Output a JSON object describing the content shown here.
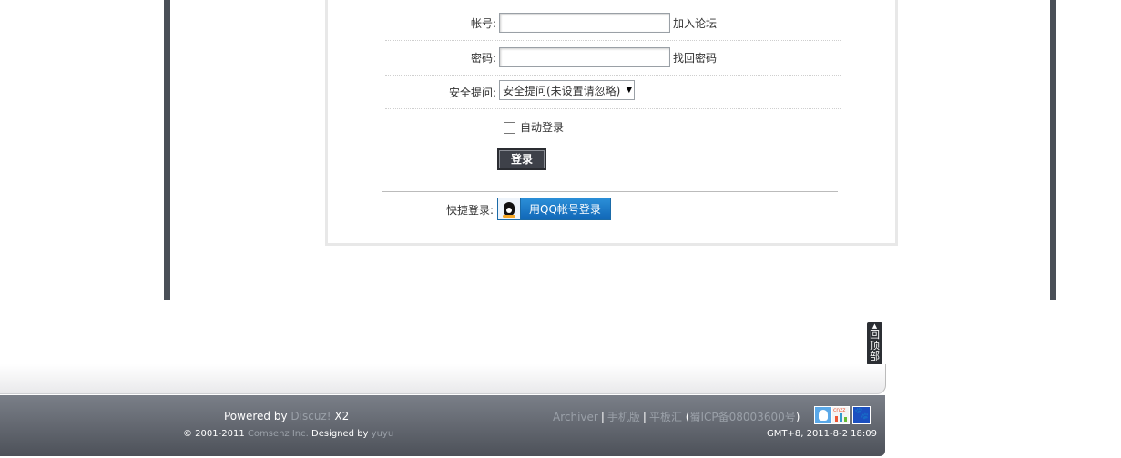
{
  "login": {
    "username_label": "帐号:",
    "username_value": "",
    "register_link": "加入论坛",
    "password_label": "密码:",
    "password_value": "",
    "forgot_link": "找回密码",
    "security_label": "安全提问:",
    "security_selected": "安全提问(未设置请忽略)",
    "auto_login_label": "自动登录",
    "auto_login_checked": false,
    "submit_label": "登录",
    "quick_login_label": "快捷登录:",
    "qq_login_label": "用QQ帐号登录"
  },
  "back_to_top": {
    "label": "回顶部"
  },
  "footer": {
    "powered_prefix": "Powered by",
    "powered_product": "Discuz!",
    "powered_version": "X2",
    "copyright": "© 2001-2011",
    "company": "Comsenz Inc.",
    "designed_by": "Designed by",
    "designer": "yuyu",
    "links": [
      "Archiver",
      "手机版",
      "平板汇"
    ],
    "icp_open": "(",
    "icp": "蜀ICP备08003600号",
    "icp_close": ")",
    "cnzz_label": "cnzz",
    "timestamp": "GMT+8, 2011-8-2 18:09",
    "badges": [
      "qq-icon",
      "cnzz-icon",
      "baidu-icon"
    ]
  },
  "colors": {
    "frame": "#4a4f57",
    "qq_button": "#1f7cc8",
    "login_button": "#3e4149",
    "footer": "#5e636b"
  }
}
